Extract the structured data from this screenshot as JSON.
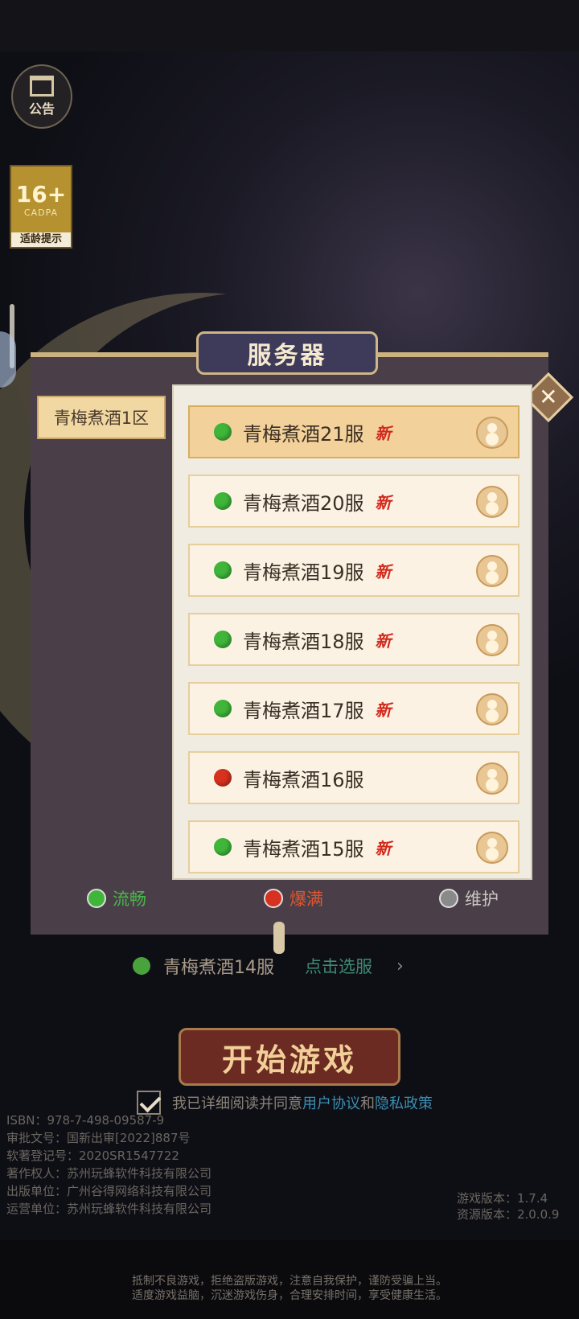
{
  "notice": {
    "label": "公告"
  },
  "age_rating": {
    "value": "16+",
    "org": "CADPA",
    "tip": "适龄提示"
  },
  "dialog": {
    "title": "服务器",
    "close_icon": "close-icon",
    "zone": "青梅煮酒1区",
    "servers": [
      {
        "name": "青梅煮酒21服",
        "tag": "新",
        "status": "green"
      },
      {
        "name": "青梅煮酒20服",
        "tag": "新",
        "status": "green"
      },
      {
        "name": "青梅煮酒19服",
        "tag": "新",
        "status": "green"
      },
      {
        "name": "青梅煮酒18服",
        "tag": "新",
        "status": "green"
      },
      {
        "name": "青梅煮酒17服",
        "tag": "新",
        "status": "green"
      },
      {
        "name": "青梅煮酒16服",
        "tag": "",
        "status": "red"
      },
      {
        "name": "青梅煮酒15服",
        "tag": "新",
        "status": "green"
      }
    ],
    "legend": [
      {
        "label": "流畅",
        "color": "#3fb63a",
        "text_color": "#49b64a"
      },
      {
        "label": "爆满",
        "color": "#d7311f",
        "text_color": "#e0562f"
      },
      {
        "label": "维护",
        "color": "#8a8a8a",
        "text_color": "#c9c6c0"
      }
    ]
  },
  "current_server": {
    "name": "青梅煮酒14服",
    "action": "点击选服",
    "arrow": "›"
  },
  "start_button": {
    "label": "开始游戏"
  },
  "agreement": {
    "prefix": "我已详细阅读并同意",
    "link1": "用户协议",
    "and": "和",
    "link2": "隐私政策"
  },
  "legal": [
    "ISBN：978-7-498-09587-9",
    "审批文号：国新出审[2022]887号",
    "软著登记号：2020SR1547722",
    "著作权人：苏州玩蜂软件科技有限公司",
    "出版单位：广州谷得网络科技有限公司",
    "运营单位：苏州玩蜂软件科技有限公司"
  ],
  "version": {
    "game": "游戏版本：1.7.4",
    "resource": "资源版本：2.0.0.9"
  },
  "health_warning": [
    "抵制不良游戏，拒绝盗版游戏，注意自我保护，谨防受骗上当。",
    "适度游戏益脑，沉迷游戏伤身，合理安排时间，享受健康生活。"
  ],
  "colors": {
    "green": "#3fb63a",
    "red": "#d7311f",
    "accent": "#cbb27e"
  }
}
